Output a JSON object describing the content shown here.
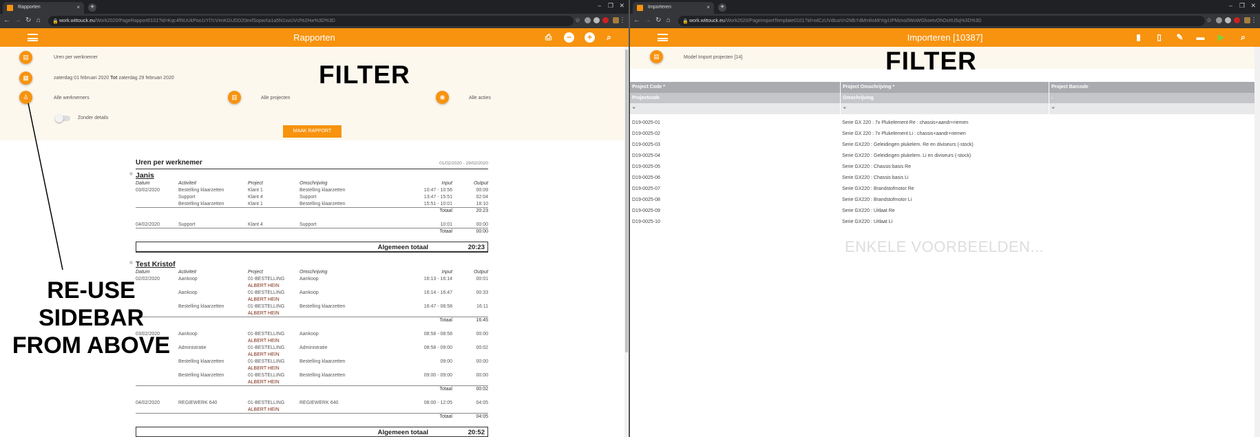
{
  "left": {
    "tab_title": "Rapporten",
    "url_domain": "work.wittouck.eu",
    "url_path": "/Work2020/PageRapport0101?id=Kqc4fNUUkPoo1rYl7cVImKGUDD20exfSopwXa1a5N1xuUVcl%2Hw%3D%3D",
    "header_title": "Rapporten",
    "header_icons": [
      "print-icon",
      "minus-circle-icon",
      "plus-circle-icon",
      "search-icon"
    ],
    "filter": {
      "report_type": "Uren per werknemer",
      "date_from": "zaterdag 01 februari 2020",
      "date_sep": "Tot",
      "date_to": "zaterdag 29 februari 2020",
      "employees": "Alle werknemers",
      "projects": "Alle projecten",
      "actions": "Alle acties",
      "toggle_label": "Zonder details",
      "toggle_on": false,
      "button": "MAAK RAPPORT"
    },
    "report": {
      "title": "Uren per werknemer",
      "period": "01/02/2020 - 29/02/2020",
      "columns": [
        "Datum",
        "Activiteit",
        "Project",
        "Omschrijving",
        "Input",
        "Output"
      ],
      "total_label": "Totaal",
      "grand_total_label": "Algemeen totaal",
      "employees": [
        {
          "name": "Janis",
          "days": [
            {
              "date": "03/02/2020",
              "total": "20:23",
              "entries": [
                {
                  "activity": "Bestelling klaarzetten",
                  "project": [
                    "Klant 1"
                  ],
                  "description": "Bestelling klaarzetten",
                  "input": "10:47 - 10:56",
                  "output": "00:09"
                },
                {
                  "activity": "Support",
                  "project": [
                    "Klant 4"
                  ],
                  "description": "Support",
                  "input": "13:47 - 15:51",
                  "output": "02:04"
                },
                {
                  "activity": "Bestelling klaarzetten",
                  "project": [
                    "Klant 1"
                  ],
                  "description": "Bestelling klaarzetten",
                  "input": "15:51 - 10:01",
                  "output": "18:10"
                }
              ]
            },
            {
              "date": "04/02/2020",
              "total": "00:00",
              "entries": [
                {
                  "activity": "Support",
                  "project": [
                    "Klant 4"
                  ],
                  "description": "Support",
                  "input": "10:01",
                  "output": "00:00"
                }
              ]
            }
          ],
          "grand_total": "20:23"
        },
        {
          "name": "Test Kristof",
          "days": [
            {
              "date": "02/02/2020",
              "total": "16:45",
              "entries": [
                {
                  "activity": "Aankoop",
                  "project": [
                    "01-BESTELLING",
                    "ALBERT HEIN"
                  ],
                  "description": "Aankoop",
                  "input": "16:13 - 16:14",
                  "output": "00:01"
                },
                {
                  "activity": "Aankoop",
                  "project": [
                    "01-BESTELLING",
                    "ALBERT HEIN"
                  ],
                  "description": "Aankoop",
                  "input": "16:14 - 16:47",
                  "output": "00:33"
                },
                {
                  "activity": "Bestelling klaarzetten",
                  "project": [
                    "01-BESTELLING",
                    "ALBERT HEIN"
                  ],
                  "description": "Bestelling klaarzetten",
                  "input": "16:47 - 08:58",
                  "output": "16:11"
                }
              ]
            },
            {
              "date": "03/02/2020",
              "total": "00:02",
              "entries": [
                {
                  "activity": "Aankoop",
                  "project": [
                    "01-BESTELLING",
                    "ALBERT HEIN"
                  ],
                  "description": "Aankoop",
                  "input": "08:58 - 08:58",
                  "output": "00:00"
                },
                {
                  "activity": "Administratie",
                  "project": [
                    "01-BESTELLING",
                    "ALBERT HEIN"
                  ],
                  "description": "Administratie",
                  "input": "08:58 - 09:00",
                  "output": "00:02"
                },
                {
                  "activity": "Bestelling klaarzetten",
                  "project": [
                    "01-BESTELLING",
                    "ALBERT HEIN"
                  ],
                  "description": "Bestelling klaarzetten",
                  "input": "09:00",
                  "output": "00:00"
                },
                {
                  "activity": "Bestelling klaarzetten",
                  "project": [
                    "01-BESTELLING",
                    "ALBERT HEIN"
                  ],
                  "description": "Bestelling klaarzetten",
                  "input": "09:00 - 09:00",
                  "output": "00:00"
                }
              ]
            },
            {
              "date": "04/02/2020",
              "total": "04:05",
              "entries": [
                {
                  "activity": "REGIEWERK 640",
                  "project": [
                    "01-BESTELLING",
                    "ALBERT HEIN"
                  ],
                  "description": "REGIEWERK 640",
                  "input": "08:00 - 12:05",
                  "output": "04:05"
                }
              ]
            }
          ],
          "grand_total": "20:52"
        }
      ]
    }
  },
  "right": {
    "tab_title": "Importeren",
    "url_domain": "work.wittouck.eu",
    "url_path": "/Work2020/PageImportTemplate0101?id=wlCzUVdtuoVn2MbYdMmlIoMIYqyUPMzno0WoWGhoetvOhOoIIU5q%3D%3D",
    "header_title": "Importeren [10387]",
    "header_icons": [
      "file-icon",
      "file-outline-icon",
      "edit-icon",
      "trash-icon",
      "play-icon",
      "search-icon"
    ],
    "filter_text": "Model Import projecten [14]",
    "table": {
      "headers": [
        "Project Code *",
        "Project Omschrijving *",
        "Project Barcode"
      ],
      "mappings": [
        "Projectcode",
        "Omschrijving",
        "-"
      ],
      "rows": [
        [
          "D19-0025-01",
          "Serie GX 220 : 7x Plukelement Re : chassis+aandr+riemen"
        ],
        [
          "D19-0025-02",
          "Serie GX 220 : 7x Plukelement Li : chassis+aandr+riemen"
        ],
        [
          "D19-0025-03",
          "Serie GX220 : Geleidingen plukelem. Re en diviseurs (-stock)"
        ],
        [
          "D19-0025-04",
          "Serie GX220 : Geleidingen plukelem. Li en diviseurs (-stock)"
        ],
        [
          "D19-0025-05",
          "Serie GX220 : Chassis basis Re"
        ],
        [
          "D19-0025-06",
          "Serie GX220 : Chassis basis Li"
        ],
        [
          "D19-0025-07",
          "Serie GX220 : Brandstofmotor Re"
        ],
        [
          "D19-0025-08",
          "Serie GX220 : Brandstofmotor Li"
        ],
        [
          "D19-0025-09",
          "Serie GX220 : Uitlaat Re"
        ],
        [
          "D19-0025-10",
          "Serie GX220 : Uitlaat Li"
        ]
      ]
    }
  },
  "annotations": {
    "filter_left": "FILTER",
    "filter_right": "FILTER",
    "sidebar_note": "RE-USE SIDEBAR FROM ABOVE",
    "examples_note": "ENKELE VOORBEELDEN..."
  },
  "colors": {
    "accent": "#f7930f",
    "filter_bg": "#fdf8ee",
    "header_gray": "#a9abaf"
  }
}
